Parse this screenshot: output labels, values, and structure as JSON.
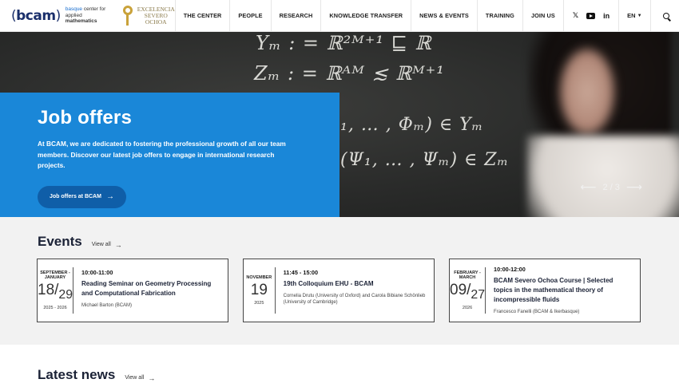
{
  "header": {
    "logo_text": "bcam",
    "tagline_line1": "basque",
    "tagline_line1b": "center for",
    "tagline_line2": "applied",
    "tagline_line2b": "mathematics",
    "severo_line1": "EXCELENCIA",
    "severo_line2": "SEVERO",
    "severo_line3": "OCHOA",
    "nav": [
      "THE CENTER",
      "PEOPLE",
      "RESEARCH",
      "KNOWLEDGE TRANSFER",
      "NEWS & EVENTS",
      "TRAINING",
      "JOIN US"
    ],
    "social": {
      "twitter": "twitter-icon",
      "youtube": "youtube-icon",
      "linkedin": "in"
    },
    "language": "EN",
    "search_icon": "search-icon"
  },
  "hero": {
    "chalk_line1": "Yₘ : = ℝ²ᴹ⁺¹ ⊑ ℝ",
    "chalk_line2": "Zₘ : = ℝᴬᴹ  ≲  ℝᴹ⁺¹",
    "chalk_line3": "₁, … , Φₘ) ∈ Yₘ",
    "chalk_line4": "(Ψ₁, … , Ψₘ) ∈ Zₘ",
    "title": "Job offers",
    "text": "At BCAM, we are dedicated to fostering the professional growth of all our team members. Discover our latest job offers to engage in international research projects.",
    "button_label": "Job offers at BCAM",
    "slide_counter": "2 / 3"
  },
  "events": {
    "title": "Events",
    "view_all": "View all",
    "items": [
      {
        "month": "SEPTEMBER - JANUARY",
        "day_start": "18",
        "day_end": "29",
        "year": "2025 - 2026",
        "time": "10:00-11:00",
        "title": "Reading Seminar on Geometry Processing and Computational Fabrication",
        "speaker": "Michael Barton (BCAM)"
      },
      {
        "month": "NOVEMBER",
        "day": "19",
        "year": "2025",
        "time": "11:45 - 15:00",
        "title": "19th Colloquium EHU - BCAM",
        "speaker": "Cornelia Drutu (University of Oxford) and Carola Bibiane Schönlieb (University of Cambridge)"
      },
      {
        "month": "FEBRUARY - MARCH",
        "day_start": "09",
        "day_end": "27",
        "year": "2026",
        "time": "10:00-12:00",
        "title": "BCAM Severo Ochoa Course | Selected topics in the mathematical theory of incompressible fluids",
        "speaker": "Francesco Fanelli (BCAM & Ikerbasque)"
      }
    ]
  },
  "news": {
    "title": "Latest news",
    "view_all": "View all"
  },
  "colors": {
    "accent_blue": "#1a87d8",
    "button_blue": "#0f5ea8",
    "navy": "#1b2236"
  }
}
